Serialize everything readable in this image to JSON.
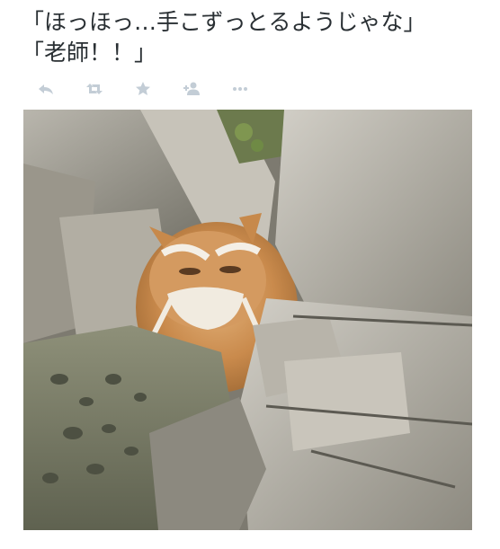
{
  "tweet": {
    "line1": "「ほっほっ…手こずっとるようじゃな」",
    "line2": "「老師！！」"
  },
  "actions": [
    {
      "name": "reply",
      "icon": "reply-icon"
    },
    {
      "name": "retweet",
      "icon": "retweet-icon"
    },
    {
      "name": "favorite",
      "icon": "star-icon"
    },
    {
      "name": "follow",
      "icon": "add-user-icon"
    },
    {
      "name": "more",
      "icon": "more-icon"
    }
  ],
  "colors": {
    "icon": "#c3cdd6",
    "text": "#292f33"
  },
  "photo": {
    "subject": "longhair-cat-among-rocks-icon"
  }
}
